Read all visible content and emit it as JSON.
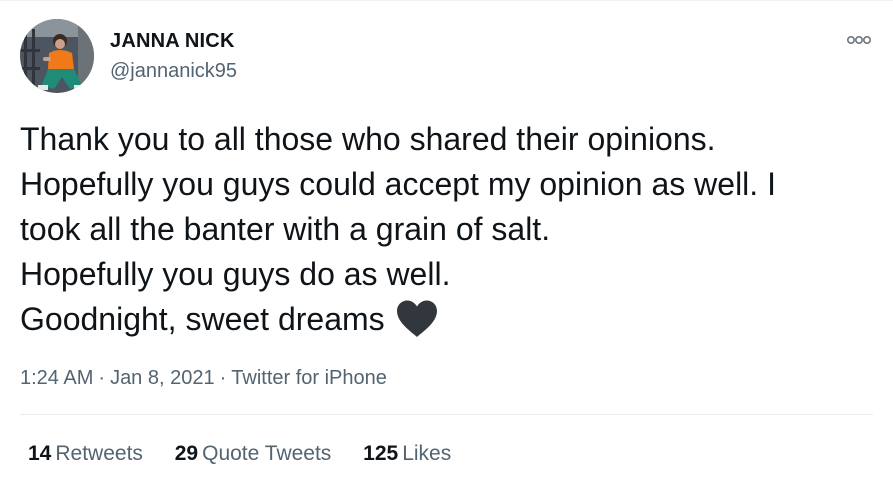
{
  "user": {
    "display_name": "JANNA NICK",
    "handle": "@jannanick95"
  },
  "tweet": {
    "lines": [
      "Thank you to all those who shared their opinions.",
      "Hopefully you guys could accept my opinion as well. I",
      "took all the banter with a grain of salt.",
      "Hopefully you guys do as well.",
      "Goodnight, sweet dreams"
    ],
    "emoji": "black-heart-icon"
  },
  "meta": {
    "time": "1:24 AM",
    "separator": "·",
    "date": "Jan 8, 2021",
    "source": "Twitter for iPhone"
  },
  "stats": {
    "retweets_count": "14",
    "retweets_label": "Retweets",
    "quotes_count": "29",
    "quotes_label": "Quote Tweets",
    "likes_count": "125",
    "likes_label": "Likes"
  },
  "colors": {
    "text_primary": "#0f1419",
    "text_secondary": "#536471",
    "divider": "#e6ecf0",
    "heart": "#31373d"
  }
}
